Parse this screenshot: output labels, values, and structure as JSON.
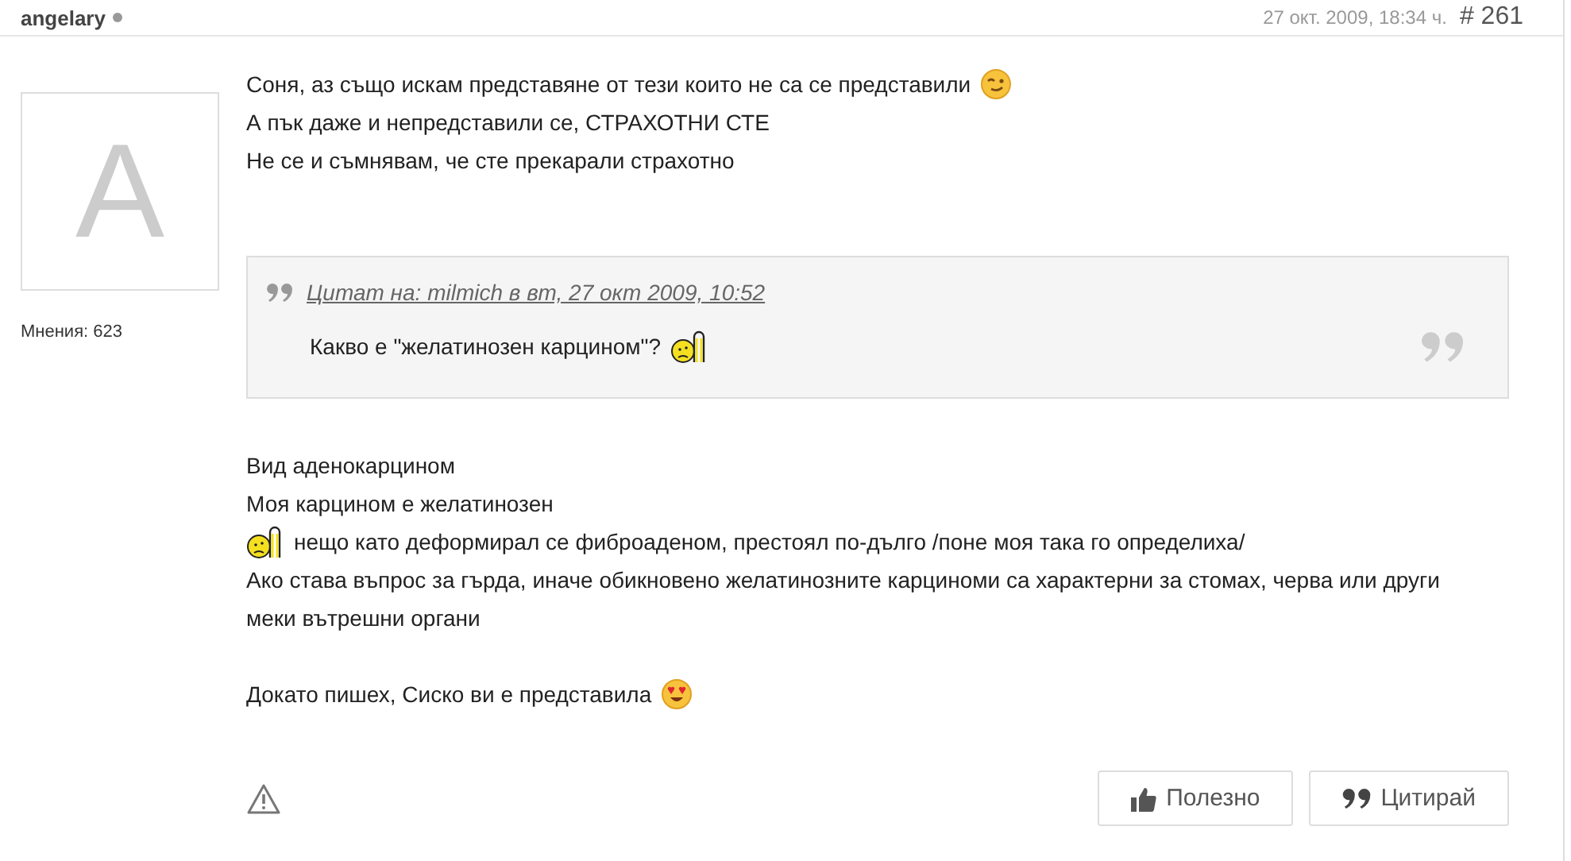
{
  "author": {
    "name": "angelary",
    "online": false
  },
  "date": "27 окт. 2009, 18:34 ч.",
  "post_number": "# 261",
  "avatar": {
    "letter": "A"
  },
  "opinions": "Мнения: 623",
  "intro": [
    {
      "kind": "line",
      "parts": [
        {
          "kind": "text",
          "text": "Соня, аз също искам представяне от тези които не са се представили"
        },
        {
          "kind": "wink"
        }
      ]
    },
    {
      "kind": "line",
      "parts": [
        {
          "kind": "text",
          "text": "А пък даже и непредставили се, СТРАХОТНИ СТЕ"
        }
      ]
    },
    {
      "kind": "line",
      "parts": [
        {
          "kind": "text",
          "text": "Не се и съмнявам, че сте прекарали страхотно"
        }
      ]
    }
  ],
  "quote": {
    "cite": "Цитат на: milmich в вт, 27 окт 2009, 10:52",
    "kind": "line",
    "parts": [
      {
        "kind": "text",
        "text": "Какво е \"желатинозен карцином\"?"
      },
      {
        "kind": "hammer"
      }
    ]
  },
  "reply": [
    {
      "kind": "line",
      "parts": [
        {
          "kind": "text",
          "text": "Вид аденокарцином"
        }
      ]
    },
    {
      "kind": "line",
      "parts": [
        {
          "kind": "text",
          "text": "Моя карцином е желатинозен"
        }
      ]
    },
    {
      "kind": "line",
      "parts": [
        {
          "kind": "hammer"
        },
        {
          "kind": "text",
          "text": "нещо като деформирал се фиброаденом, престоял по-дълго /поне моя така го определиха/"
        }
      ]
    },
    {
      "kind": "line",
      "parts": [
        {
          "kind": "text",
          "text": "Ако става въпрос за гърда, иначе обикновено желатинозните карциноми са характерни за стомах, черва или други меки вътрешни органи"
        }
      ]
    },
    {
      "kind": "blank"
    },
    {
      "kind": "line",
      "parts": [
        {
          "kind": "text",
          "text": "Докато пишех, Сиско ви е представила"
        },
        {
          "kind": "love"
        }
      ]
    }
  ],
  "actions": [
    {
      "label": "Полезно"
    },
    {
      "label": "Цитирай"
    }
  ]
}
